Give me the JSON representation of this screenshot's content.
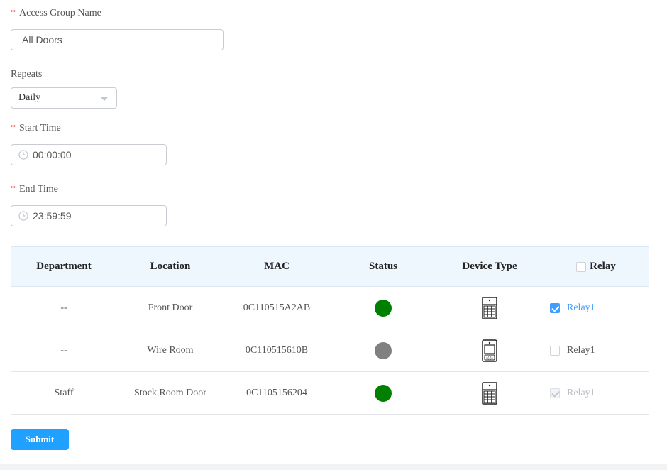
{
  "form": {
    "access_group_name": {
      "label": "Access Group Name",
      "required_mark": "*",
      "value": "All Doors"
    },
    "repeats": {
      "label": "Repeats",
      "selected": "Daily"
    },
    "start_time": {
      "label": "Start Time",
      "required_mark": "*",
      "value": "00:00:00"
    },
    "end_time": {
      "label": "End Time",
      "required_mark": "*",
      "value": "23:59:59"
    }
  },
  "table": {
    "headers": {
      "department": "Department",
      "location": "Location",
      "mac": "MAC",
      "status": "Status",
      "device_type": "Device Type",
      "relay": "Relay"
    },
    "rows": [
      {
        "department": "--",
        "location": "Front Door",
        "mac": "0C110515A2AB",
        "status_color": "#008000",
        "device_icon": "keypad-door-phone-icon",
        "relay": "Relay1",
        "relay_state": "checked"
      },
      {
        "department": "--",
        "location": "Wire Room",
        "mac": "0C110515610B",
        "status_color": "#808080",
        "device_icon": "card-reader-door-phone-icon",
        "relay": "Relay1",
        "relay_state": "unchecked"
      },
      {
        "department": "Staff",
        "location": "Stock Room Door",
        "mac": "0C1105156204",
        "status_color": "#008000",
        "device_icon": "keypad-door-phone-icon",
        "relay": "Relay1",
        "relay_state": "checked-disabled"
      }
    ]
  },
  "submit_label": "Submit",
  "colors": {
    "accent": "#20a0ff",
    "online": "#008000",
    "offline": "#808080",
    "required": "#f56c6c"
  }
}
